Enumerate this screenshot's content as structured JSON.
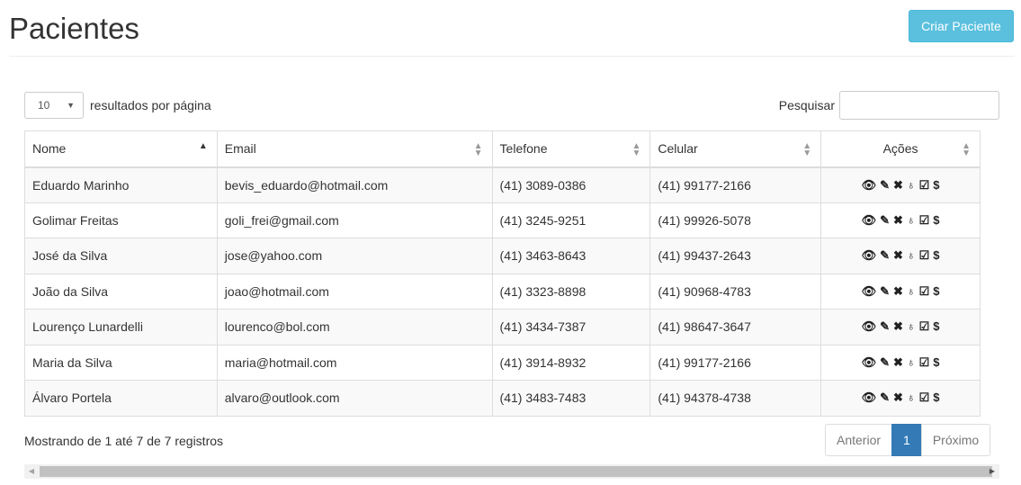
{
  "page": {
    "title": "Pacientes",
    "create_button": "Criar Paciente"
  },
  "controls": {
    "page_length": "10",
    "page_length_suffix": "resultados por página",
    "search_label": "Pesquisar",
    "search_value": ""
  },
  "table": {
    "columns": [
      "Nome",
      "Email",
      "Telefone",
      "Celular",
      "Ações"
    ],
    "sort_column": "Nome",
    "sort_direction": "asc",
    "rows": [
      {
        "nome": "Eduardo Marinho",
        "email": "bevis_eduardo@hotmail.com",
        "telefone": "(41) 3089-0386",
        "celular": "(41) 99177-2166"
      },
      {
        "nome": "Golimar Freitas",
        "email": "goli_frei@gmail.com",
        "telefone": "(41) 3245-9251",
        "celular": "(41) 99926-5078"
      },
      {
        "nome": "José da Silva",
        "email": "jose@yahoo.com",
        "telefone": "(41) 3463-8643",
        "celular": "(41) 99437-2643"
      },
      {
        "nome": "João da Silva",
        "email": "joao@hotmail.com",
        "telefone": "(41) 3323-8898",
        "celular": "(41) 90968-4783"
      },
      {
        "nome": "Lourenço Lunardelli",
        "email": "lourenco@bol.com",
        "telefone": "(41) 3434-7387",
        "celular": "(41) 98647-3647"
      },
      {
        "nome": "Maria da Silva",
        "email": "maria@hotmail.com",
        "telefone": "(41) 3914-8932",
        "celular": "(41) 99177-2166"
      },
      {
        "nome": "Álvaro Portela",
        "email": "alvaro@outlook.com",
        "telefone": "(41) 3483-7483",
        "celular": "(41) 94378-4738"
      }
    ],
    "action_icons": [
      "eye-icon",
      "pencil-icon",
      "times-icon",
      "stethoscope-icon",
      "edit-icon",
      "dollar-icon"
    ]
  },
  "footer": {
    "info": "Mostrando de 1 até 7 de 7 registros",
    "prev": "Anterior",
    "page": "1",
    "next": "Próximo"
  },
  "colors": {
    "create_button": "#5bc0de",
    "active_page": "#337ab7",
    "row_stripe": "#f9f9f9",
    "border": "#dddddd"
  }
}
